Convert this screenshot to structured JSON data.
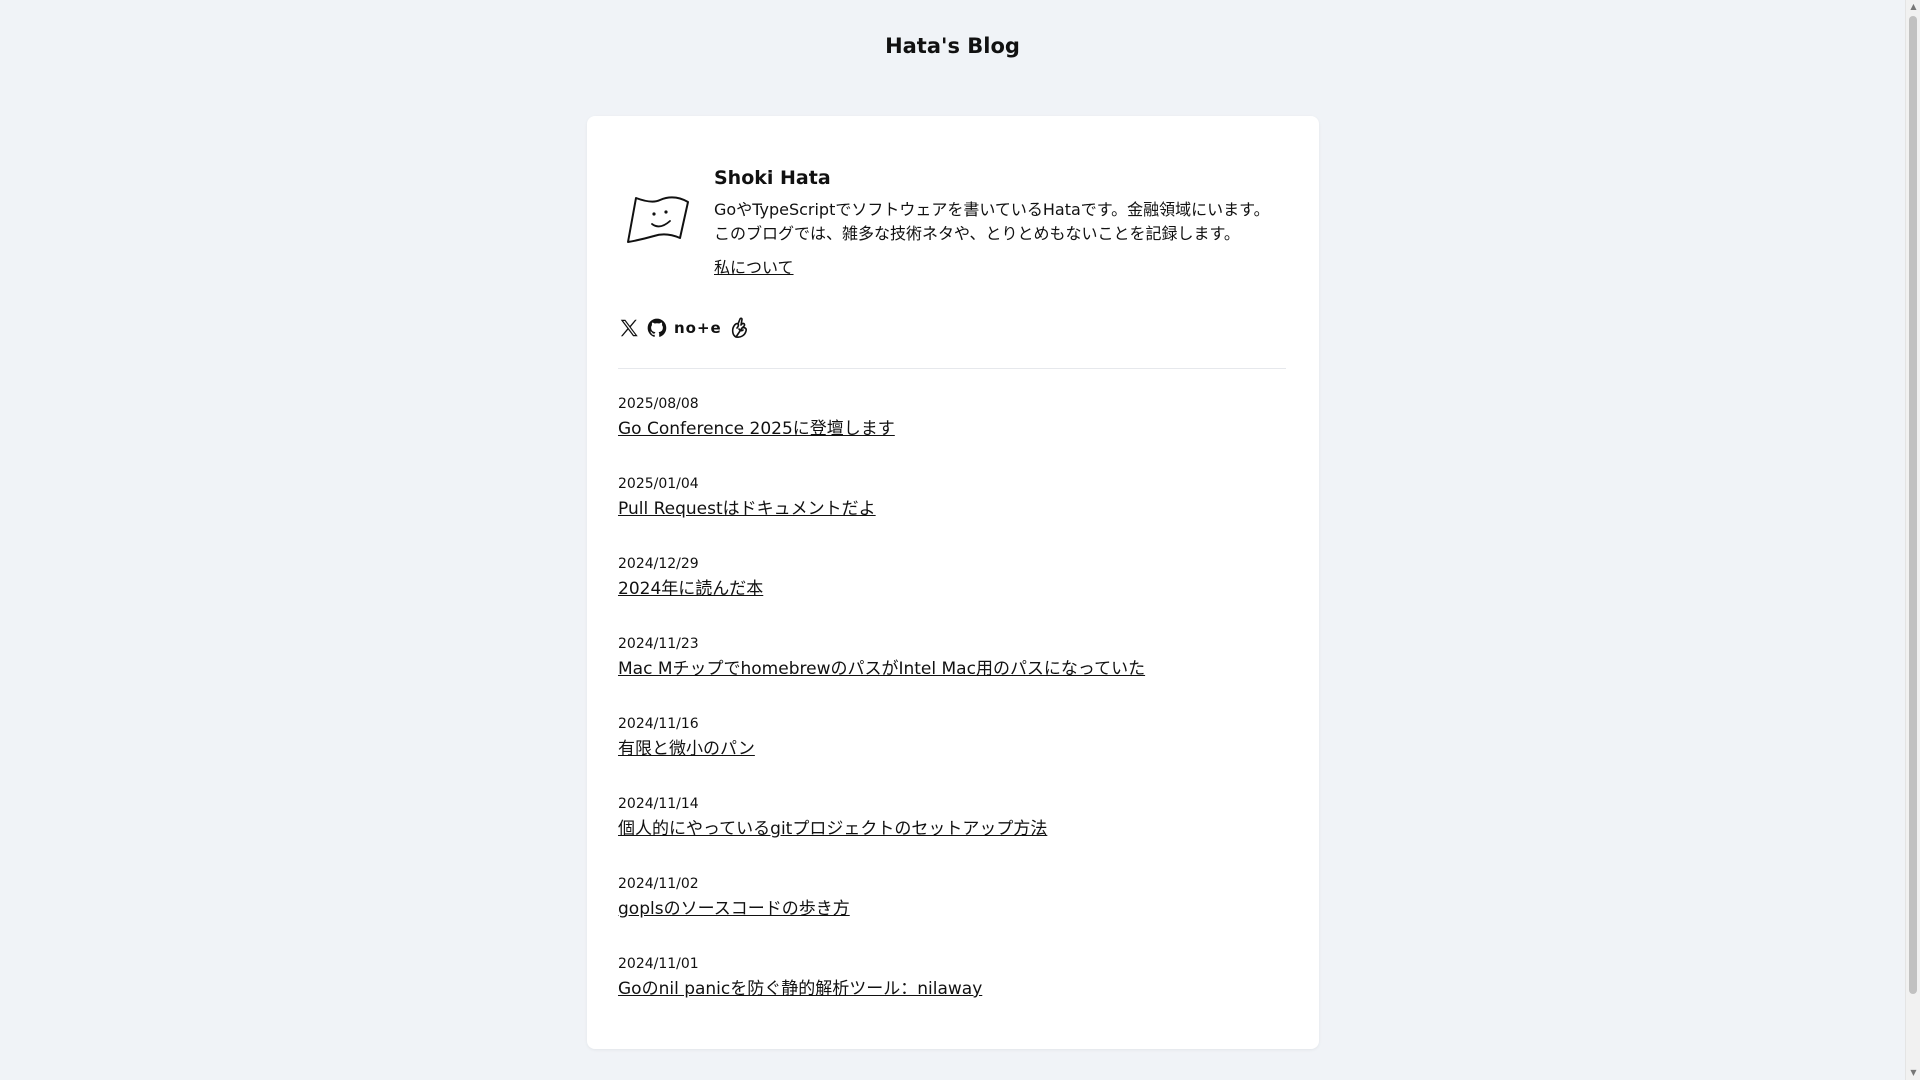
{
  "site": {
    "title": "Hata's Blog"
  },
  "profile": {
    "name": "Shoki Hata",
    "bio_line1": "GoやTypeScriptでソフトウェアを書いているHataです。金融領域にいます。",
    "bio_line2": "このブログでは、雑多な技術ネタや、とりとめもないことを記録します。",
    "about_link": "私について",
    "avatar_icon": "flag-face-icon"
  },
  "social": {
    "x_icon": "x-logo-icon",
    "github_icon": "github-icon",
    "note_label": "no+e",
    "other_icon": "hand-sign-icon"
  },
  "posts": [
    {
      "date": "2025/08/08",
      "title": "Go Conference 2025に登壇します"
    },
    {
      "date": "2025/01/04",
      "title": "Pull Requestはドキュメントだよ"
    },
    {
      "date": "2024/12/29",
      "title": "2024年に読んだ本"
    },
    {
      "date": "2024/11/23",
      "title": "Mac MチップでhomebrewのパスがIntel Mac用のパスになっていた"
    },
    {
      "date": "2024/11/16",
      "title": "有限と微小のパン"
    },
    {
      "date": "2024/11/14",
      "title": "個人的にやっているgitプロジェクトのセットアップ方法"
    },
    {
      "date": "2024/11/02",
      "title": "goplsのソースコードの歩き方"
    },
    {
      "date": "2024/11/01",
      "title": "Goのnil panicを防ぐ静的解析ツール：nilaway"
    }
  ],
  "colors": {
    "background": "#f0f3f7",
    "card": "#ffffff",
    "text": "#111111",
    "divider": "#e6e8ec"
  }
}
